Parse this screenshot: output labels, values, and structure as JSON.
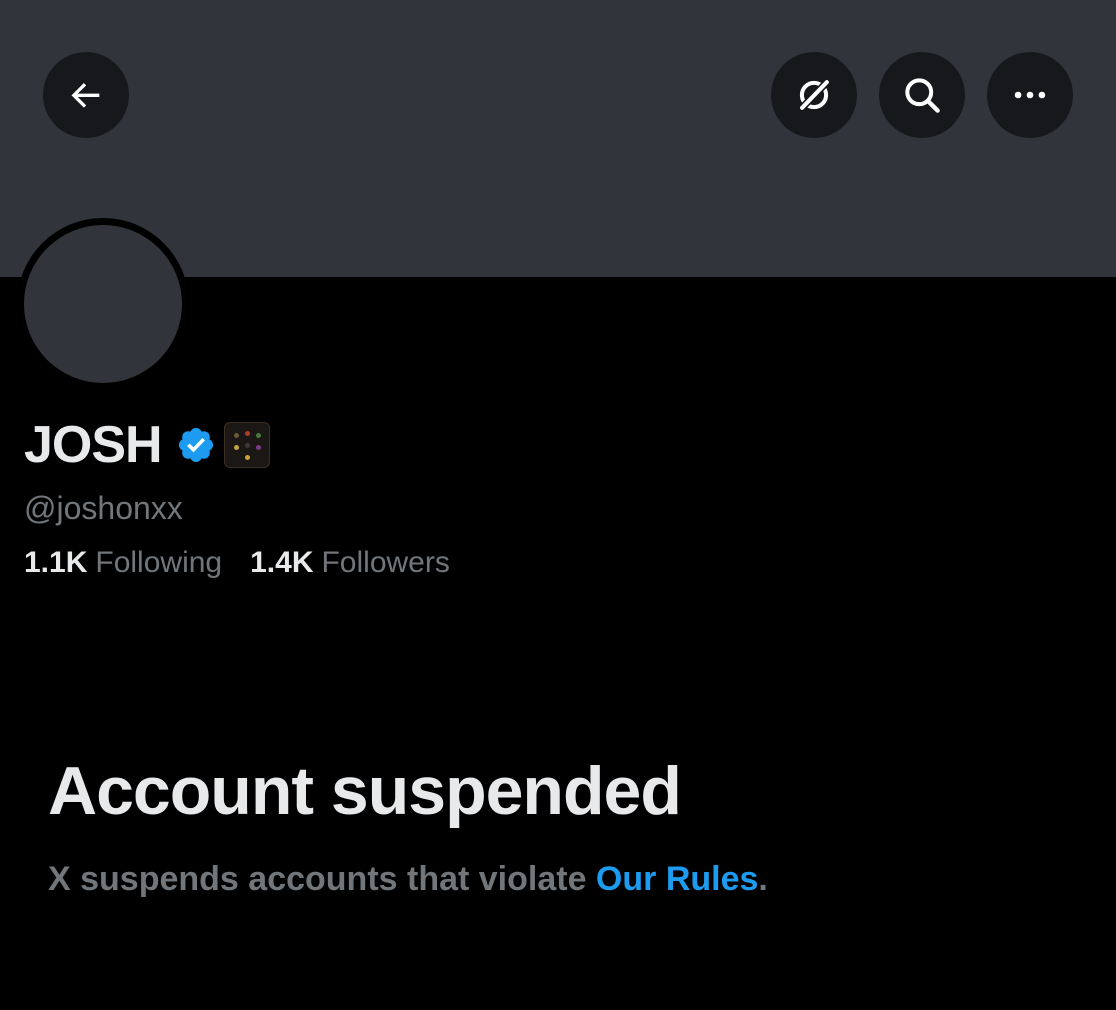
{
  "header": {
    "buttons": {
      "back": "back-arrow-icon",
      "grok": "grok-icon",
      "search": "search-icon",
      "more": "more-icon"
    }
  },
  "profile": {
    "display_name": "JOSH",
    "verified_color": "#1d9bf0",
    "handle": "@joshonxx",
    "following_count": "1.1K",
    "following_label": "Following",
    "followers_count": "1.4K",
    "followers_label": "Followers"
  },
  "notice": {
    "title": "Account suspended",
    "body_prefix": "X suspends accounts that violate ",
    "link_text": "Our Rules",
    "body_suffix": "."
  },
  "colors": {
    "banner": "#31343a",
    "background": "#000000",
    "text_primary": "#e7e9ea",
    "text_secondary": "#71767b",
    "accent": "#1d9bf0"
  }
}
